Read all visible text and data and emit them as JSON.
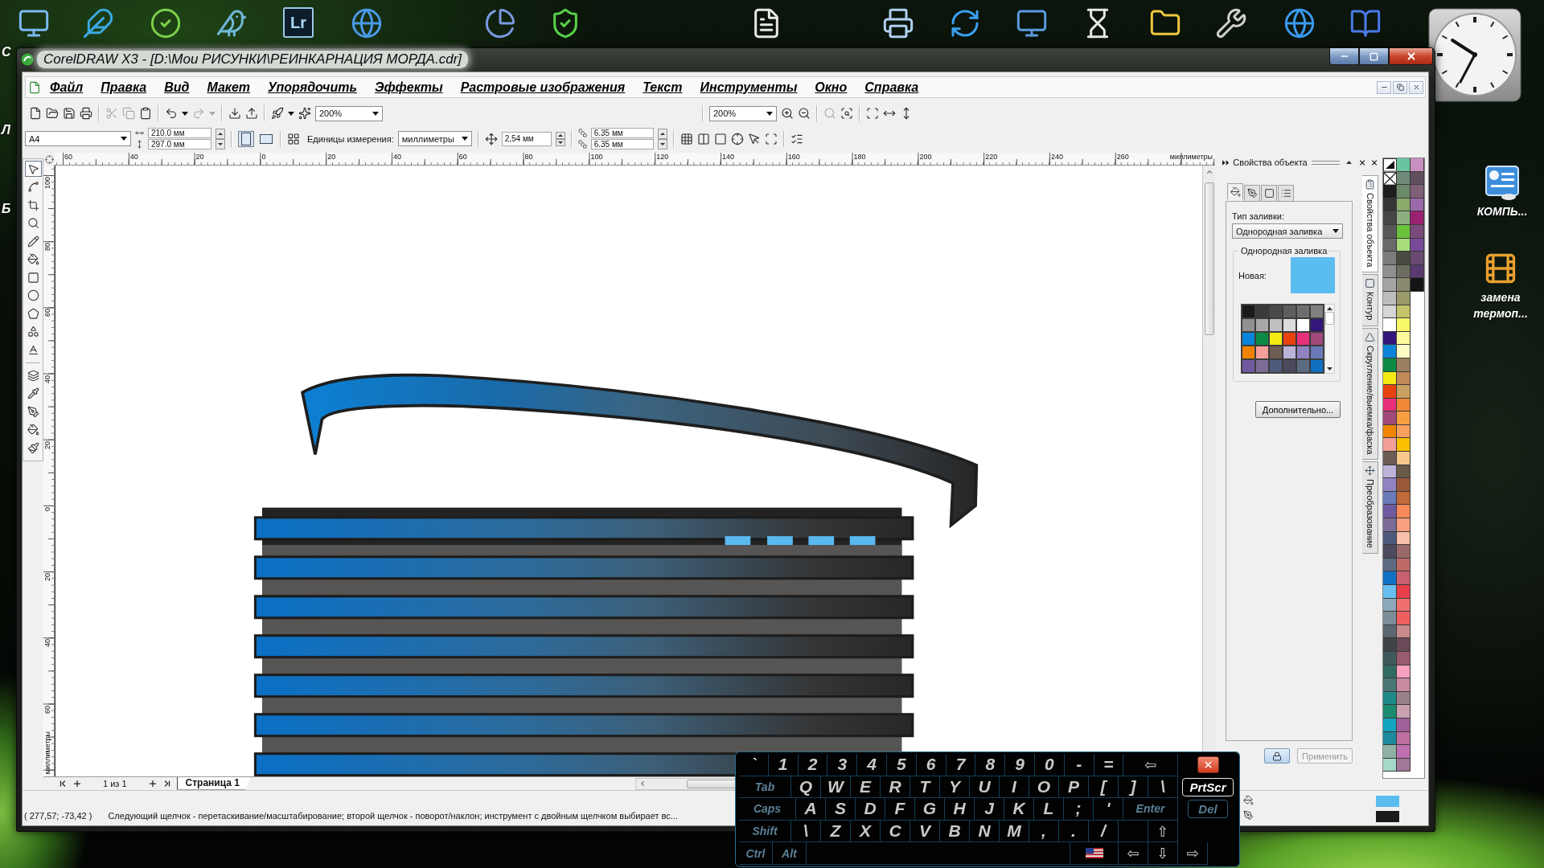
{
  "desktop": {
    "edge_labels": [
      "С",
      "Л",
      "Б"
    ],
    "tile_text": "Lr",
    "shortcuts": [
      {
        "label": "КОМПЬ..."
      },
      {
        "label": "замена термоп..."
      }
    ]
  },
  "window": {
    "title": "CorelDRAW X3 - [D:\\Мои РИСУНКИ\\РЕИНКАРНАЦИЯ МОРДА.cdr]",
    "menu": [
      "Файл",
      "Правка",
      "Вид",
      "Макет",
      "Упорядочить",
      "Эффекты",
      "Растровые изображения",
      "Текст",
      "Инструменты",
      "Окно",
      "Справка"
    ]
  },
  "toolbar": {
    "cut_copy_disabled": true,
    "redo_disabled": true,
    "zoom": "200%",
    "zoom_2": "200%",
    "zoom_selected_disabled": true
  },
  "property_bar": {
    "paper": "A4",
    "width": "210.0 мм",
    "height": "297.0 мм",
    "orientations": [
      {
        "kind": "portrait",
        "selected": true
      },
      {
        "kind": "landscape",
        "selected": false
      }
    ],
    "units_label": "Единицы измерения:",
    "units": "миллиметры",
    "nudge": "2,54 мм",
    "duplicate_x": "6.35 мм",
    "duplicate_y": "6.35 мм"
  },
  "toolbox": {
    "tools": [
      {
        "selected": true
      },
      {
        "selected": false
      },
      {
        "selected": false
      },
      {
        "selected": false
      },
      {
        "selected": false
      },
      {
        "selected": false
      },
      {
        "selected": false
      },
      {
        "selected": false
      },
      {
        "selected": false
      },
      {
        "selected": false
      },
      {
        "selected": false
      },
      {
        "selected": false
      },
      {
        "selected": false
      },
      {
        "selected": false
      },
      {
        "selected": false
      },
      {
        "selected": false
      }
    ]
  },
  "rulers": {
    "horizontal": [
      "60",
      "40",
      "20",
      "0",
      "20",
      "40",
      "60",
      "80",
      "100",
      "120",
      "140",
      "160",
      "180",
      "200",
      "220",
      "240",
      "260"
    ],
    "horizontal_unit": "миллиметры",
    "vertical": [
      "100",
      "80",
      "60",
      "40",
      "20",
      "0",
      "20",
      "40",
      "60"
    ],
    "vertical_unit": "миллиметры"
  },
  "page_nav": {
    "count": "1 из 1",
    "tabs": [
      {
        "label": "Страница 1",
        "selected": true
      }
    ]
  },
  "docker": {
    "title": "Свойства объекта",
    "tabs": [
      {
        "selected": true
      },
      {
        "selected": false
      },
      {
        "selected": false
      },
      {
        "selected": false
      }
    ],
    "fill_type_label": "Тип заливки:",
    "fill_type": "Однородная заливка",
    "group_title": "Однородная заливка",
    "fill_colors": [
      {
        "label": "Новая:",
        "color": "#5bbcf0"
      }
    ],
    "swatches": [
      {
        "color": "#1a1a1a"
      },
      {
        "color": "#3a3a3a"
      },
      {
        "color": "#4a4a4a"
      },
      {
        "color": "#5e5e5e"
      },
      {
        "color": "#6e6e6e"
      },
      {
        "color": "#808080"
      },
      {
        "color": "#909090"
      },
      {
        "color": "#a8a8a8"
      },
      {
        "color": "#c0c0c0"
      },
      {
        "color": "#dcdcdc"
      },
      {
        "color": "#ffffff"
      },
      {
        "color": "#33167a"
      },
      {
        "color": "#0a84d8"
      },
      {
        "color": "#0a8a45"
      },
      {
        "color": "#f5ea14"
      },
      {
        "color": "#e8420f"
      },
      {
        "color": "#e8307a"
      },
      {
        "color": "#a0497a"
      },
      {
        "color": "#f08400"
      },
      {
        "color": "#f4a09a"
      },
      {
        "color": "#6e5d55"
      },
      {
        "color": "#bcb3d9"
      },
      {
        "color": "#9183c0"
      },
      {
        "color": "#6a7ab9"
      },
      {
        "color": "#6f5aa0"
      },
      {
        "color": "#7c6c98"
      },
      {
        "color": "#4e5a7c"
      },
      {
        "color": "#4c4a5e"
      },
      {
        "color": "#5c6b82"
      },
      {
        "color": "#1071c3"
      }
    ],
    "more_button": "Дополнительно...",
    "apply_button": {
      "label": "Применить",
      "disabled": true
    },
    "side_tabs": [
      {
        "label": "Свойства объекта",
        "selected": true
      },
      {
        "label": "Контур",
        "selected": false
      },
      {
        "label": "Скругление/выемка/фаска",
        "selected": false
      },
      {
        "label": "Преобразование",
        "selected": false
      }
    ]
  },
  "palette": {
    "columns": [
      {
        "swatches": [
          {
            "color": "#1e1e1e"
          },
          {
            "color": "#353535"
          },
          {
            "color": "#464646"
          },
          {
            "color": "#575757"
          },
          {
            "color": "#6a6a6a"
          },
          {
            "color": "#7c7c7c"
          },
          {
            "color": "#909090"
          },
          {
            "color": "#a5a5a5"
          },
          {
            "color": "#bdbdbd"
          },
          {
            "color": "#d6d6d6"
          },
          {
            "color": "#ffffff"
          },
          {
            "color": "#33167a"
          },
          {
            "color": "#0a84d8"
          },
          {
            "color": "#0a8a45"
          },
          {
            "color": "#f5ea14"
          },
          {
            "color": "#e8420f"
          },
          {
            "color": "#e8307a"
          },
          {
            "color": "#a0497a"
          },
          {
            "color": "#f08400"
          },
          {
            "color": "#f4a09a"
          },
          {
            "color": "#6e5d55"
          },
          {
            "color": "#bcb3d9"
          },
          {
            "color": "#9183c0"
          },
          {
            "color": "#6a7ab9"
          },
          {
            "color": "#6f5aa0"
          },
          {
            "color": "#7c6c98"
          },
          {
            "color": "#4e5a7c"
          },
          {
            "color": "#4c4a5e"
          },
          {
            "color": "#5c6b82"
          },
          {
            "color": "#1071c3"
          },
          {
            "color": "#66bff0"
          },
          {
            "color": "#8ea8bc"
          },
          {
            "color": "#7d8e99"
          },
          {
            "color": "#5b6670"
          },
          {
            "color": "#3f4446"
          },
          {
            "color": "#3f5a5a"
          },
          {
            "color": "#326b62"
          },
          {
            "color": "#477674"
          },
          {
            "color": "#1c8a88"
          },
          {
            "color": "#1a8a70"
          },
          {
            "color": "#11a5c0"
          },
          {
            "color": "#1e8a9e"
          },
          {
            "color": "#8fb0a5"
          },
          {
            "color": "#a5d8c8"
          }
        ]
      },
      {
        "swatches": [
          {
            "color": "#6ac4a0"
          },
          {
            "color": "#6f8a78"
          },
          {
            "color": "#6c8a6a"
          },
          {
            "color": "#8aaa6c"
          },
          {
            "color": "#8eb080"
          },
          {
            "color": "#6ac23a"
          },
          {
            "color": "#a6dc7a"
          },
          {
            "color": "#4a4a40"
          },
          {
            "color": "#6e6e60"
          },
          {
            "color": "#8a8a70"
          },
          {
            "color": "#9a9a6a"
          },
          {
            "color": "#c4c46a"
          },
          {
            "color": "#f8f86a"
          },
          {
            "color": "#fafa9a"
          },
          {
            "color": "#fcfcc4"
          },
          {
            "color": "#9a8060"
          },
          {
            "color": "#c08a5a"
          },
          {
            "color": "#c8a060"
          },
          {
            "color": "#f08838"
          },
          {
            "color": "#f8a040"
          },
          {
            "color": "#f8a060"
          },
          {
            "color": "#fac000"
          },
          {
            "color": "#f8c88a"
          },
          {
            "color": "#6a5a48"
          },
          {
            "color": "#9a5a3a"
          },
          {
            "color": "#c06a3a"
          },
          {
            "color": "#f88a5a"
          },
          {
            "color": "#f8a080"
          },
          {
            "color": "#f8c0a8"
          },
          {
            "color": "#9a6a6a"
          },
          {
            "color": "#c06a68"
          },
          {
            "color": "#c86070"
          },
          {
            "color": "#e8404a"
          },
          {
            "color": "#f07070"
          },
          {
            "color": "#f06060"
          },
          {
            "color": "#c88a8a"
          },
          {
            "color": "#6a4a58"
          },
          {
            "color": "#9a5a70"
          },
          {
            "color": "#f8a0c0"
          },
          {
            "color": "#c88aa0"
          },
          {
            "color": "#9a8088"
          },
          {
            "color": "#c8a0b0"
          },
          {
            "color": "#a0609a"
          },
          {
            "color": "#c070a0"
          },
          {
            "color": "#c070b0"
          },
          {
            "color": "#a07898"
          }
        ]
      },
      {
        "swatches": [
          {
            "color": "#c890c0"
          },
          {
            "color": "#604e5c"
          },
          {
            "color": "#806078"
          },
          {
            "color": "#9a6aaa"
          },
          {
            "color": "#9a2070"
          },
          {
            "color": "#7a4a78"
          },
          {
            "color": "#7a4a9a"
          },
          {
            "color": "#6a4a70"
          },
          {
            "color": "#5a3a70"
          },
          {
            "color": "#141414"
          }
        ]
      }
    ]
  },
  "status_bar": {
    "coordinates": "( 277,57; -73,42 )",
    "hint": "Следующий щелчок - перетаскивание/масштабирование; второй щелчок - поворот/наклон; инструмент с двойным щелчком выбирает вс...",
    "swatches": [
      {
        "color": "#5bbcf0"
      },
      {
        "color": "#1a1a1a"
      }
    ]
  },
  "keyboard": {
    "rows": [
      {
        "keys": [
          {
            "label": "`",
            "kind": "char"
          },
          {
            "label": "1",
            "kind": "char"
          },
          {
            "label": "2",
            "kind": "char"
          },
          {
            "label": "3",
            "kind": "char"
          },
          {
            "label": "4",
            "kind": "char"
          },
          {
            "label": "5",
            "kind": "char"
          },
          {
            "label": "6",
            "kind": "char"
          },
          {
            "label": "7",
            "kind": "char"
          },
          {
            "label": "8",
            "kind": "char"
          },
          {
            "label": "9",
            "kind": "char"
          },
          {
            "label": "0",
            "kind": "char"
          },
          {
            "label": "-",
            "kind": "char"
          },
          {
            "label": "=",
            "kind": "char"
          },
          {
            "label": "⇦",
            "kind": "wide"
          }
        ]
      },
      {
        "keys": [
          {
            "label": "Tab",
            "kind": "mod"
          },
          {
            "label": "Q",
            "kind": "char"
          },
          {
            "label": "W",
            "kind": "char"
          },
          {
            "label": "E",
            "kind": "char"
          },
          {
            "label": "R",
            "kind": "char"
          },
          {
            "label": "T",
            "kind": "char"
          },
          {
            "label": "Y",
            "kind": "char"
          },
          {
            "label": "U",
            "kind": "char"
          },
          {
            "label": "I",
            "kind": "char"
          },
          {
            "label": "O",
            "kind": "char"
          },
          {
            "label": "P",
            "kind": "char"
          },
          {
            "label": "[",
            "kind": "char"
          },
          {
            "label": "]",
            "kind": "char"
          },
          {
            "label": "\\",
            "kind": "char"
          }
        ]
      },
      {
        "keys": [
          {
            "label": "Caps",
            "kind": "mod"
          },
          {
            "label": "A",
            "kind": "char"
          },
          {
            "label": "S",
            "kind": "char"
          },
          {
            "label": "D",
            "kind": "char"
          },
          {
            "label": "F",
            "kind": "char"
          },
          {
            "label": "G",
            "kind": "char"
          },
          {
            "label": "H",
            "kind": "char"
          },
          {
            "label": "J",
            "kind": "char"
          },
          {
            "label": "K",
            "kind": "char"
          },
          {
            "label": "L",
            "kind": "char"
          },
          {
            "label": ";",
            "kind": "char"
          },
          {
            "label": "'",
            "kind": "char"
          },
          {
            "label": "Enter",
            "kind": "widemod"
          }
        ]
      },
      {
        "keys": [
          {
            "label": "Shift",
            "kind": "mod"
          },
          {
            "label": "\\",
            "kind": "char"
          },
          {
            "label": "Z",
            "kind": "char"
          },
          {
            "label": "X",
            "kind": "char"
          },
          {
            "label": "C",
            "kind": "char"
          },
          {
            "label": "V",
            "kind": "char"
          },
          {
            "label": "B",
            "kind": "char"
          },
          {
            "label": "N",
            "kind": "char"
          },
          {
            "label": "M",
            "kind": "char"
          },
          {
            "label": ",",
            "kind": "char"
          },
          {
            "label": ".",
            "kind": "char"
          },
          {
            "label": "/",
            "kind": "char"
          },
          {
            "kind": "blank"
          },
          {
            "label": "⇧",
            "kind": "arrow"
          }
        ]
      },
      {
        "keys": [
          {
            "label": "Ctrl",
            "kind": "mod"
          },
          {
            "label": "Alt",
            "kind": "mod"
          },
          {
            "kind": "space"
          },
          {
            "kind": "flag"
          },
          {
            "label": "⇦",
            "kind": "arrow"
          },
          {
            "label": "⇩",
            "kind": "arrow"
          },
          {
            "label": "⇨",
            "kind": "arrow"
          }
        ]
      }
    ],
    "side_keys": [
      {
        "kind": "close",
        "highlighted": false
      },
      {
        "kind": "key",
        "label": "PrtScr",
        "highlighted": true
      },
      {
        "kind": "key",
        "label": "Del",
        "highlighted": false
      }
    ]
  }
}
